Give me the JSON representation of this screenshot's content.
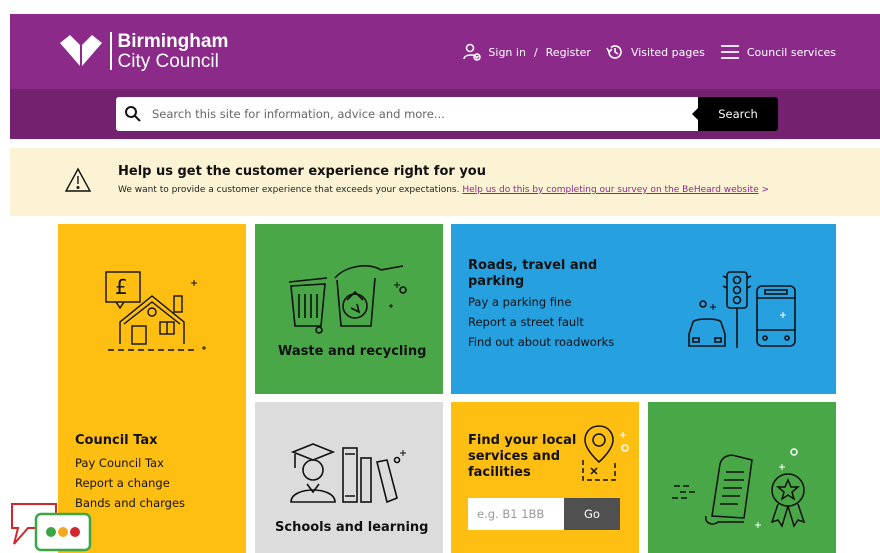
{
  "header": {
    "logo_line1": "Birmingham",
    "logo_line2": "City Council",
    "sign_in": "Sign in",
    "separator": "/",
    "register": "Register",
    "visited": "Visited pages",
    "services": "Council services"
  },
  "search": {
    "placeholder": "Search this site for information, advice and more...",
    "button": "Search"
  },
  "alert": {
    "title": "Help us get the customer experience right for you",
    "body": "We want to provide a customer experience that exceeds your expectations.",
    "link": "Help us do this by completing our survey on the BeHeard website",
    "chevron": ">"
  },
  "tiles": {
    "council_tax": {
      "title": "Council Tax",
      "links": [
        "Pay Council Tax",
        "Report a change",
        "Bands and charges"
      ]
    },
    "waste": {
      "title": "Waste and recycling"
    },
    "roads": {
      "title_line1": "Roads, travel and",
      "title_line2": "parking",
      "links": [
        "Pay a parking fine",
        "Report a street fault",
        "Find out about roadworks"
      ]
    },
    "schools": {
      "title": "Schools and learning"
    },
    "find": {
      "title_line1": "Find your local",
      "title_line2": "services and",
      "title_line3": "facilities",
      "placeholder": "e.g. B1 1BB",
      "button": "Go"
    }
  },
  "colors": {
    "purple": "#8b2a89",
    "purple_dark": "#74226f",
    "yellow": "#ffbf12",
    "green": "#4aa748",
    "blue": "#26a0de",
    "grey": "#dcdcdc",
    "alert_bg": "#fcf3d4"
  }
}
